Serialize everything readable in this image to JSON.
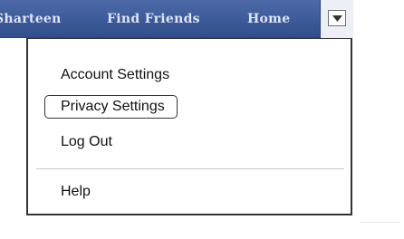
{
  "nav": {
    "profile_label": "Sharteen",
    "find_friends_label": "Find Friends",
    "home_label": "Home",
    "dropdown_icon": "chevron-down-icon"
  },
  "menu": {
    "items": [
      {
        "label": "Account Settings"
      },
      {
        "label": "Privacy Settings"
      },
      {
        "label": "Log Out"
      },
      {
        "label": "Help"
      }
    ]
  },
  "colors": {
    "topbar": "#3b5998",
    "nav_text": "#dfe5f1",
    "menu_border": "#333333"
  }
}
